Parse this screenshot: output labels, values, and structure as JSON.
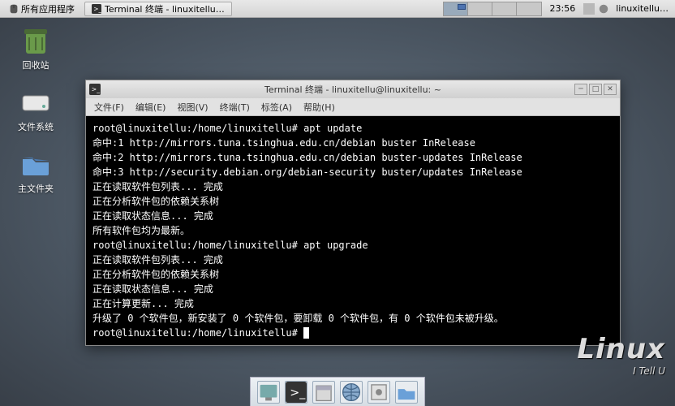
{
  "panel": {
    "apps_label": "所有应用程序",
    "taskbar_item": "Terminal 终端 - linuxitellu…",
    "clock": "23:56",
    "username": "linuxitellu…"
  },
  "desktop": {
    "icons": [
      {
        "label": "回收站"
      },
      {
        "label": "文件系统"
      },
      {
        "label": "主文件夹"
      }
    ]
  },
  "terminal": {
    "title": "Terminal 终端 - linuxitellu@linuxitellu: ~",
    "menu": [
      "文件(F)",
      "编辑(E)",
      "视图(V)",
      "终端(T)",
      "标签(A)",
      "帮助(H)"
    ],
    "lines": [
      "root@linuxitellu:/home/linuxitellu# apt update",
      "命中:1 http://mirrors.tuna.tsinghua.edu.cn/debian buster InRelease",
      "命中:2 http://mirrors.tuna.tsinghua.edu.cn/debian buster-updates InRelease",
      "命中:3 http://security.debian.org/debian-security buster/updates InRelease",
      "正在读取软件包列表... 完成",
      "正在分析软件包的依赖关系树",
      "正在读取状态信息... 完成",
      "所有软件包均为最新。",
      "root@linuxitellu:/home/linuxitellu# apt upgrade",
      "正在读取软件包列表... 完成",
      "正在分析软件包的依赖关系树",
      "正在读取状态信息... 完成",
      "正在计算更新... 完成",
      "升级了 0 个软件包，新安装了 0 个软件包，要卸载 0 个软件包，有 0 个软件包未被升级。",
      "root@linuxitellu:/home/linuxitellu# "
    ]
  },
  "watermark": {
    "big": "Linux",
    "small": "I Tell U"
  }
}
